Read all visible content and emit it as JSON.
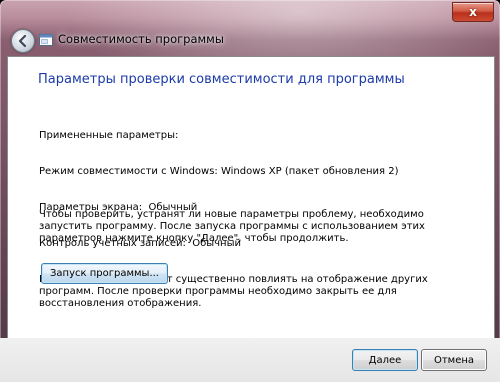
{
  "window": {
    "title": "Совместимость программы",
    "close_symbol": "x",
    "back_icon": "back-arrow-icon",
    "title_icon": "program-compat-icon"
  },
  "main": {
    "heading": "Параметры проверки совместимости для программы",
    "applied_lines": [
      "Примененные параметры:",
      "Режим совместимости с Windows: Windows XP (пакет обновления 2)",
      "Параметры экрана:  Обычный",
      "Контроль учетных записей:  Обычный",
      "Параметры экрана могут существенно повлиять на отображение других программ. После проверки программы необходимо закрыть ее для восстановления отображения."
    ],
    "paragraph2": "Чтобы проверить, устранят ли новые параметры проблему, необходимо запустить программу. После запуска программы с использованием этих параметров нажмите кнопку \"Далее\", чтобы продолжить.",
    "launch_button": "Запуск программы..."
  },
  "footer": {
    "next_button": "Далее",
    "cancel_button": "Отмена"
  }
}
